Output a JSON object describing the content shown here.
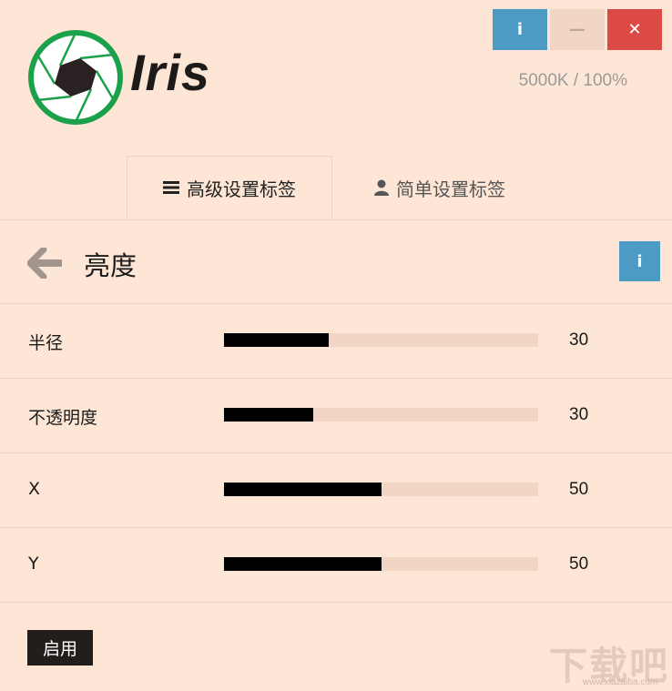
{
  "window": {
    "info_label": "i",
    "minimize_label": "—",
    "close_label": "✕"
  },
  "status": "5000K / 100%",
  "logo": {
    "text": "Iris"
  },
  "tabs": [
    {
      "label": "高级设置标签",
      "icon": "list-icon",
      "active": true
    },
    {
      "label": "简单设置标签",
      "icon": "user-icon",
      "active": false
    }
  ],
  "section": {
    "title": "亮度",
    "info_label": "i"
  },
  "sliders": [
    {
      "label": "半径",
      "value": "30",
      "fill_fraction": 0.333
    },
    {
      "label": "不透明度",
      "value": "30",
      "fill_fraction": 0.284
    },
    {
      "label": "X",
      "value": "50",
      "fill_fraction": 0.5
    },
    {
      "label": "Y",
      "value": "50",
      "fill_fraction": 0.5
    }
  ],
  "enable_button": "启用",
  "watermark": {
    "text": "下载吧",
    "sub": "www.xiazaiba.com"
  },
  "colors": {
    "background": "#fee6d6",
    "info": "#4d9ac5",
    "close": "#dc4a46",
    "logo_green": "#1aa14a",
    "track": "#f1d6c6",
    "fill": "#000000"
  }
}
